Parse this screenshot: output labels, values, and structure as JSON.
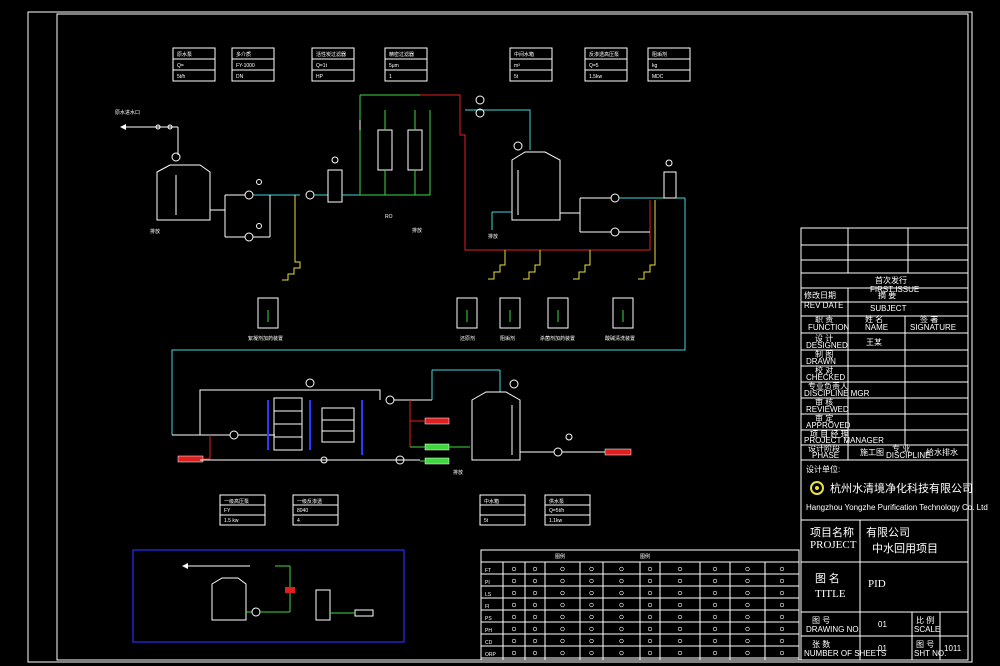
{
  "colors": {
    "background": "#000000",
    "line_white": "#ffffff",
    "pipe_green": "#3fd83f",
    "pipe_red": "#e02020",
    "pipe_cyan": "#40d8d8",
    "pipe_yellow": "#e8e040",
    "pipe_blue": "#2a3aff",
    "frame_blue": "#2a2aff"
  },
  "top_labels": [
    {
      "title": "原水泵",
      "spec": "Q=",
      "value": "5t/h"
    },
    {
      "title": "多介质",
      "spec": "FY-1000",
      "value": "DN"
    },
    {
      "title": "活性炭过滤器",
      "spec": "Q=1t",
      "value": "HP"
    },
    {
      "title": "精密过滤器",
      "spec": "5μm",
      "value": "1"
    },
    {
      "title": "中间水箱",
      "spec": "m³",
      "value": "5t"
    },
    {
      "title": "反渗透高压泵",
      "spec": "Q=5",
      "value": "1.5kw"
    },
    {
      "title": "阻垢剂",
      "spec": "kg",
      "value": "MDC"
    }
  ],
  "bottom_labels": [
    {
      "title": "一级高压泵",
      "spec": "FY",
      "value": "1.5 kw"
    },
    {
      "title": "一级反渗透",
      "spec": "8040",
      "value": "4"
    },
    {
      "title": "中水箱",
      "spec": "",
      "value": "5t"
    },
    {
      "title": "供水泵",
      "spec": "Q=5t/h",
      "value": "1.1kw"
    }
  ],
  "process_text": {
    "raw_water_inlet": "原水进水口",
    "ro_out": "RO",
    "dosing_1": "絮凝剂加药装置",
    "dosing_2": "还原剂",
    "dosing_3": "阻垢剂",
    "dosing_4": "杀菌剂加药装置",
    "dosing_5": "酸碱清洗装置",
    "drain_1": "排放",
    "drain_2": "排放",
    "drain_3": "排放",
    "drain_4": "排放"
  },
  "title_block": {
    "first_issue_cn": "首次发行",
    "first_issue_en": "FIRST ISSUE",
    "revision_cn": "修改日期",
    "revision_en": "REV DATE",
    "subject_cn": "摘 要",
    "subject_en": "SUBJECT",
    "function_cn": "职 责",
    "function_en": "FUNCTION",
    "name_cn": "姓 名",
    "name_en": "NAME",
    "signature_cn": "签 署",
    "signature_en": "SIGNATURE",
    "designed_cn": "设 计",
    "designed_en": "DESIGNED",
    "designer_name": "王某",
    "drawn_cn": "制 图",
    "drawn_en": "DRAWN",
    "checked_cn": "校 对",
    "checked_en": "CHECKED",
    "discipline_cn": "专业负责人",
    "discipline_en": "DISCIPLINE MGR",
    "reviewed_cn": "审 核",
    "reviewed_en": "REVIEWED",
    "approved_cn": "审 定",
    "approved_en": "APPROVED",
    "project_mgr_cn": "项 目 经 理",
    "project_mgr_en": "PROJECT MANAGER",
    "phase_cn": "设计阶段",
    "phase_en": "PHASE",
    "phase_value": "施工图",
    "discipline_label": "专 业",
    "discipline_label_en": "DISCIPLINE",
    "discipline_value": "给水排水",
    "design_unit_cn": "设计单位:",
    "company_cn": "杭州水清境净化科技有限公司",
    "company_en": "Hangzhou Yongzhe Purification Technology Co. Ltd",
    "project_cn": "项目名称",
    "project_en": "PROJECT",
    "project_value_1": "有限公司",
    "project_value_2": "中水回用项目",
    "title_cn": "图 名",
    "title_en": "TITLE",
    "title_value": "PID",
    "drawing_no_cn": "图 号",
    "drawing_no_en": "DRAWING NO.",
    "drawing_no_value": "01",
    "sheets_cn": "张 数",
    "sheets_en": "NUMBER OF SHEETS",
    "sheets_value": "01",
    "scale_cn": "比 例",
    "scale_en": "SCALE",
    "sheet_cn": "图 号",
    "sheet_en": "SHT NO.",
    "sheet_value": "1011"
  },
  "legend": {
    "header_left": "图例",
    "header_right": "图例",
    "rows": [
      "FT",
      "PI",
      "LS",
      "FI",
      "PS",
      "PH",
      "CD",
      "ORP"
    ]
  }
}
